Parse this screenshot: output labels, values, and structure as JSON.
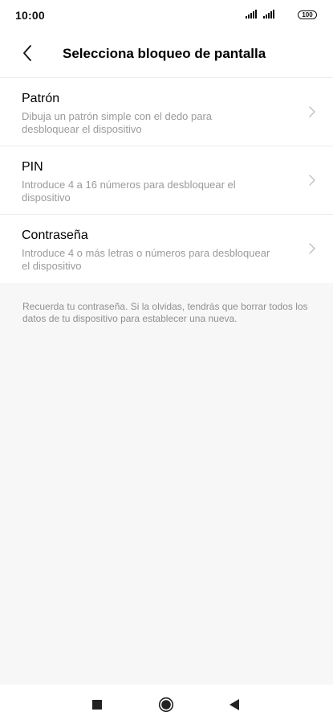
{
  "status_bar": {
    "time": "10:00",
    "battery": "100"
  },
  "header": {
    "title": "Selecciona bloqueo de pantalla",
    "back_icon": "chevron-left-icon"
  },
  "options": [
    {
      "title": "Patrón",
      "description": "Dibuja un patrón simple con el dedo para desbloquear el dispositivo"
    },
    {
      "title": "PIN",
      "description": "Introduce 4 a 16 números para desbloquear el dispositivo"
    },
    {
      "title": "Contraseña",
      "description": "Introduce 4 o más letras o números para desbloquear el dispositivo"
    }
  ],
  "note": "Recuerda tu contraseña. Si la olvidas, tendrás que borrar todos los datos de tu dispositivo para establecer una nueva.",
  "nav_bar": {
    "icons": [
      "square-recents-icon",
      "circle-home-icon",
      "triangle-back-icon"
    ]
  },
  "colors": {
    "background": "#f7f7f7",
    "surface": "#ffffff",
    "secondary_text": "#9a9a9a"
  }
}
